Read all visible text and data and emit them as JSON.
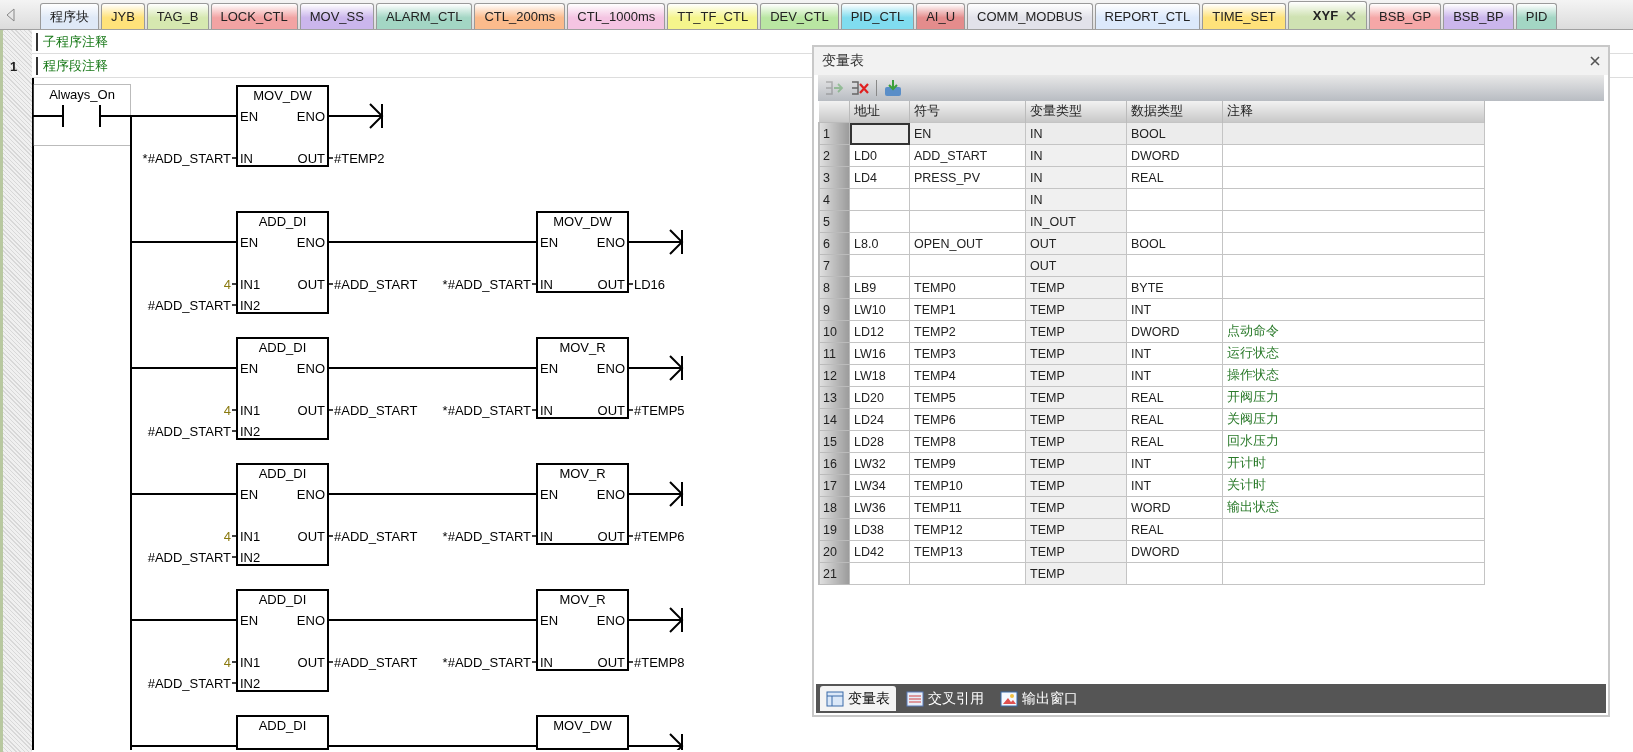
{
  "tab_bar": {
    "tabs": [
      {
        "label": "程序块",
        "color": "#dfe9f7",
        "selected": false,
        "closable": false
      },
      {
        "label": "JYB",
        "color": "#ffe27a",
        "selected": false,
        "closable": false
      },
      {
        "label": "TAG_B",
        "color": "#d6e8b0",
        "selected": false,
        "closable": false
      },
      {
        "label": "LOCK_CTL",
        "color": "#f2a3a3",
        "selected": false,
        "closable": false
      },
      {
        "label": "MOV_SS",
        "color": "#cbb6ec",
        "selected": false,
        "closable": false
      },
      {
        "label": "ALARM_CTL",
        "color": "#a3d6c4",
        "selected": false,
        "closable": false
      },
      {
        "label": "CTL_200ms",
        "color": "#fbbb8c",
        "selected": false,
        "closable": false
      },
      {
        "label": "CTL_1000ms",
        "color": "#f4c4e2",
        "selected": false,
        "closable": false
      },
      {
        "label": "TT_TF_CTL",
        "color": "#f5f58c",
        "selected": false,
        "closable": false
      },
      {
        "label": "DEV_CTL",
        "color": "#b9e6a2",
        "selected": false,
        "closable": false
      },
      {
        "label": "PID_CTL",
        "color": "#80dcef",
        "selected": false,
        "closable": false
      },
      {
        "label": "AI_U",
        "color": "#e48c8c",
        "selected": false,
        "closable": false
      },
      {
        "label": "COMM_MODBUS",
        "color": "#e2e2ea",
        "selected": false,
        "closable": false
      },
      {
        "label": "REPORT_CTL",
        "color": "#dce9fb",
        "selected": false,
        "closable": false
      },
      {
        "label": "TIME_SET",
        "color": "#ffe27a",
        "selected": false,
        "closable": false
      },
      {
        "label": "XYF",
        "color": "#cfe2b2",
        "selected": true,
        "closable": true
      },
      {
        "label": "BSB_GP",
        "color": "#f5a7a7",
        "selected": false,
        "closable": false
      },
      {
        "label": "BSB_BP",
        "color": "#cbb6ec",
        "selected": false,
        "closable": false
      },
      {
        "label": "PID",
        "color": "#a3d6c4",
        "selected": false,
        "closable": false
      }
    ]
  },
  "editor": {
    "subroutine_comment": "子程序注释",
    "network": {
      "number": "1",
      "comment": "程序段注释",
      "contact": {
        "label": "Always_On"
      },
      "rungs": [
        {
          "blocks": [
            {
              "title": "MOV_DW",
              "en": "EN",
              "eno": "ENO",
              "inputs": [
                {
                  "pin": "IN",
                  "operand": "*#ADD_START",
                  "constant": false
                }
              ],
              "outputs": [
                {
                  "pin": "OUT",
                  "operand": "#TEMP2"
                }
              ]
            }
          ]
        },
        {
          "blocks": [
            {
              "title": "ADD_DI",
              "en": "EN",
              "eno": "ENO",
              "inputs": [
                {
                  "pin": "IN1",
                  "operand": "4",
                  "constant": true
                },
                {
                  "pin": "IN2",
                  "operand": "#ADD_START",
                  "constant": false
                }
              ],
              "outputs": [
                {
                  "pin": "OUT",
                  "operand": "#ADD_START"
                }
              ]
            },
            {
              "title": "MOV_DW",
              "en": "EN",
              "eno": "ENO",
              "inputs": [
                {
                  "pin": "IN",
                  "operand": "*#ADD_START",
                  "constant": false
                }
              ],
              "outputs": [
                {
                  "pin": "OUT",
                  "operand": "LD16"
                }
              ]
            }
          ]
        },
        {
          "blocks": [
            {
              "title": "ADD_DI",
              "en": "EN",
              "eno": "ENO",
              "inputs": [
                {
                  "pin": "IN1",
                  "operand": "4",
                  "constant": true
                },
                {
                  "pin": "IN2",
                  "operand": "#ADD_START",
                  "constant": false
                }
              ],
              "outputs": [
                {
                  "pin": "OUT",
                  "operand": "#ADD_START"
                }
              ]
            },
            {
              "title": "MOV_R",
              "en": "EN",
              "eno": "ENO",
              "inputs": [
                {
                  "pin": "IN",
                  "operand": "*#ADD_START",
                  "constant": false
                }
              ],
              "outputs": [
                {
                  "pin": "OUT",
                  "operand": "#TEMP5"
                }
              ]
            }
          ]
        },
        {
          "blocks": [
            {
              "title": "ADD_DI",
              "en": "EN",
              "eno": "ENO",
              "inputs": [
                {
                  "pin": "IN1",
                  "operand": "4",
                  "constant": true
                },
                {
                  "pin": "IN2",
                  "operand": "#ADD_START",
                  "constant": false
                }
              ],
              "outputs": [
                {
                  "pin": "OUT",
                  "operand": "#ADD_START"
                }
              ]
            },
            {
              "title": "MOV_R",
              "en": "EN",
              "eno": "ENO",
              "inputs": [
                {
                  "pin": "IN",
                  "operand": "*#ADD_START",
                  "constant": false
                }
              ],
              "outputs": [
                {
                  "pin": "OUT",
                  "operand": "#TEMP6"
                }
              ]
            }
          ]
        },
        {
          "blocks": [
            {
              "title": "ADD_DI",
              "en": "EN",
              "eno": "ENO",
              "inputs": [
                {
                  "pin": "IN1",
                  "operand": "4",
                  "constant": true
                },
                {
                  "pin": "IN2",
                  "operand": "#ADD_START",
                  "constant": false
                }
              ],
              "outputs": [
                {
                  "pin": "OUT",
                  "operand": "#ADD_START"
                }
              ]
            },
            {
              "title": "MOV_R",
              "en": "EN",
              "eno": "ENO",
              "inputs": [
                {
                  "pin": "IN",
                  "operand": "*#ADD_START",
                  "constant": false
                }
              ],
              "outputs": [
                {
                  "pin": "OUT",
                  "operand": "#TEMP8"
                }
              ]
            }
          ]
        },
        {
          "blocks": [
            {
              "title": "ADD_DI"
            },
            {
              "title": "MOV_DW"
            }
          ]
        }
      ]
    }
  },
  "variable_panel": {
    "title": "变量表",
    "toolbar": [
      {
        "kind": "insert_row",
        "disabled": true
      },
      {
        "kind": "delete_row",
        "disabled": false
      },
      {
        "kind": "import",
        "disabled": false
      }
    ],
    "columns": [
      "地址",
      "符号",
      "变量类型",
      "数据类型",
      "注释"
    ],
    "rows": [
      {
        "number": "1",
        "symbol": "EN",
        "var_type": "IN",
        "data_type": "BOOL",
        "selected": true
      },
      {
        "number": "2",
        "address": "LD0",
        "symbol": "ADD_START",
        "var_type": "IN",
        "data_type": "DWORD",
        "selected": false
      },
      {
        "number": "3",
        "address": "LD4",
        "symbol": "PRESS_PV",
        "var_type": "IN",
        "data_type": "REAL",
        "selected": false
      },
      {
        "number": "4",
        "var_type": "IN",
        "selected": false
      },
      {
        "number": "5",
        "var_type": "IN_OUT",
        "selected": false
      },
      {
        "number": "6",
        "address": "L8.0",
        "symbol": "OPEN_OUT",
        "var_type": "OUT",
        "data_type": "BOOL",
        "selected": false
      },
      {
        "number": "7",
        "var_type": "OUT",
        "selected": false
      },
      {
        "number": "8",
        "address": "LB9",
        "symbol": "TEMP0",
        "var_type": "TEMP",
        "data_type": "BYTE",
        "selected": false
      },
      {
        "number": "9",
        "address": "LW10",
        "symbol": "TEMP1",
        "var_type": "TEMP",
        "data_type": "INT",
        "selected": false
      },
      {
        "number": "10",
        "address": "LD12",
        "symbol": "TEMP2",
        "var_type": "TEMP",
        "data_type": "DWORD",
        "comment": "点动命令",
        "selected": false
      },
      {
        "number": "11",
        "address": "LW16",
        "symbol": "TEMP3",
        "var_type": "TEMP",
        "data_type": "INT",
        "comment": "运行状态",
        "selected": false
      },
      {
        "number": "12",
        "address": "LW18",
        "symbol": "TEMP4",
        "var_type": "TEMP",
        "data_type": "INT",
        "comment": "操作状态",
        "selected": false
      },
      {
        "number": "13",
        "address": "LD20",
        "symbol": "TEMP5",
        "var_type": "TEMP",
        "data_type": "REAL",
        "comment": "开阀压力",
        "selected": false
      },
      {
        "number": "14",
        "address": "LD24",
        "symbol": "TEMP6",
        "var_type": "TEMP",
        "data_type": "REAL",
        "comment": "关阀压力",
        "selected": false
      },
      {
        "number": "15",
        "address": "LD28",
        "symbol": "TEMP8",
        "var_type": "TEMP",
        "data_type": "REAL",
        "comment": "回水压力",
        "selected": false
      },
      {
        "number": "16",
        "address": "LW32",
        "symbol": "TEMP9",
        "var_type": "TEMP",
        "data_type": "INT",
        "comment": "开计时",
        "selected": false
      },
      {
        "number": "17",
        "address": "LW34",
        "symbol": "TEMP10",
        "var_type": "TEMP",
        "data_type": "INT",
        "comment": "关计时",
        "selected": false
      },
      {
        "number": "18",
        "address": "LW36",
        "symbol": "TEMP11",
        "var_type": "TEMP",
        "data_type": "WORD",
        "comment": "输出状态",
        "selected": false
      },
      {
        "number": "19",
        "address": "LD38",
        "symbol": "TEMP12",
        "var_type": "TEMP",
        "data_type": "REAL",
        "selected": false
      },
      {
        "number": "20",
        "address": "LD42",
        "symbol": "TEMP13",
        "var_type": "TEMP",
        "data_type": "DWORD",
        "selected": false
      },
      {
        "number": "21",
        "var_type": "TEMP",
        "selected": false
      }
    ],
    "bottom_tabs": [
      {
        "label": "变量表",
        "kind": "table",
        "selected": true
      },
      {
        "label": "交叉引用",
        "kind": "cross_reference",
        "selected": false
      },
      {
        "label": "输出窗口",
        "kind": "output",
        "selected": false
      }
    ]
  }
}
